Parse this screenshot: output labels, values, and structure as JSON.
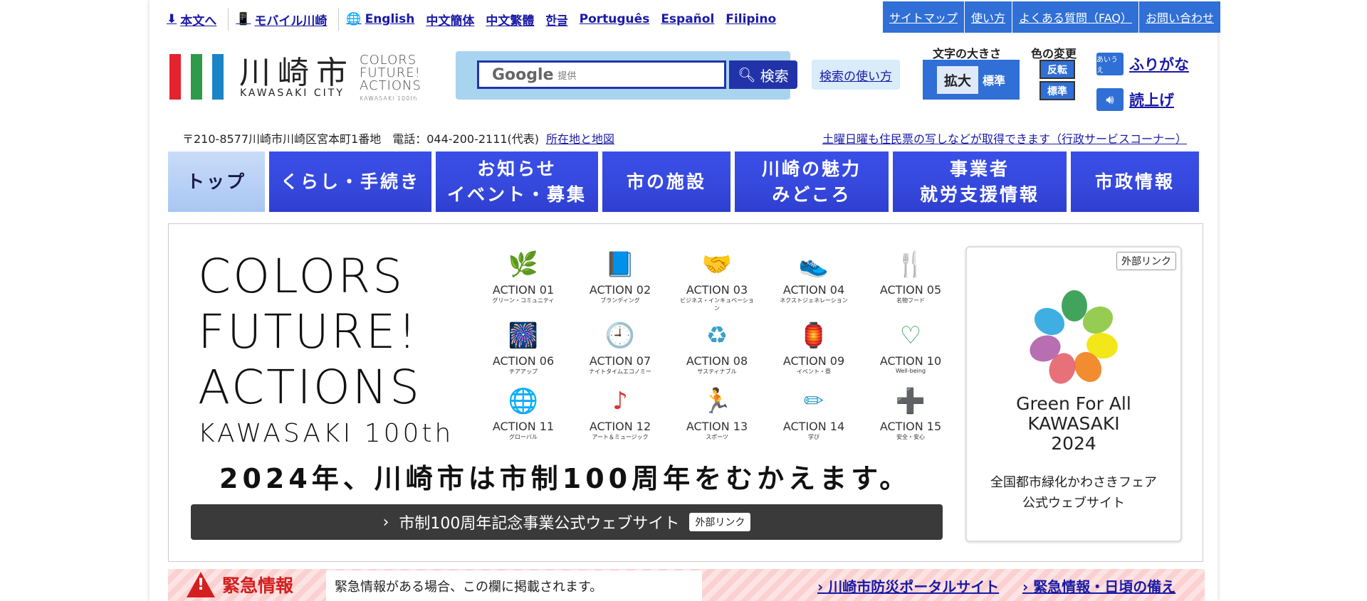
{
  "top_links": {
    "skip": "本文へ",
    "mobile": "モバイル川崎",
    "english": "English",
    "zh_cn": "中文簡体",
    "zh_tw": "中文繁體",
    "ko": "한글",
    "pt": "Português",
    "es": "Español",
    "fil": "Filipino"
  },
  "util_nav": {
    "sitemap": "サイトマップ",
    "howto": "使い方",
    "faq": "よくある質問（FAQ）",
    "contact": "お問い合わせ"
  },
  "logo": {
    "name": "川崎市",
    "sub": "KAWASAKI CITY",
    "cfa_lines": [
      "COLORS",
      "FUTURE!",
      "ACTIONS"
    ],
    "cfa_small": "KAWASAKI 100th"
  },
  "search": {
    "google": "Google",
    "provided": "提供",
    "button": "検索",
    "help": "検索の使い方"
  },
  "font_size": {
    "title": "文字の大きさ",
    "enlarge": "拡大",
    "standard": "標準"
  },
  "color_change": {
    "title": "色の変更",
    "invert": "反転",
    "standard": "標準"
  },
  "tools": {
    "furigana": "ふりがな",
    "furigana_icon": "あいうえ",
    "readaloud": "読上げ"
  },
  "address": {
    "text": "〒210-8577川崎市川崎区宮本町1番地　電話：044-200-2111(代表)",
    "map_link": "所在地と地図",
    "notice": "土曜日曜も住民票の写しなどが取得できます（行政サービスコーナー）"
  },
  "main_nav": [
    {
      "label": "トップ"
    },
    {
      "label": "くらし・手続き"
    },
    {
      "label": "お知らせ\nイベント・募集"
    },
    {
      "label": "市の施設"
    },
    {
      "label": "川崎の魅力\nみどころ"
    },
    {
      "label": "事業者\n就労支援情報"
    },
    {
      "label": "市政情報"
    }
  ],
  "banner": {
    "cfa_lines": [
      "COLORS",
      "FUTURE!",
      "ACTIONS"
    ],
    "cfa_kawasaki": "KAWASAKI 100th",
    "headline": "2024年、川崎市は市制100周年をむかえます。",
    "cta": "市制100周年記念事業公式ウェブサイト",
    "cta_badge": "外部リンク",
    "actions": [
      {
        "title": "ACTION 01",
        "sub": "グリーン・コミュニティ",
        "icon": "leaf-icon",
        "glyph": "🌿",
        "color": "#3aa55c"
      },
      {
        "title": "ACTION 02",
        "sub": "ブランディング",
        "icon": "book-icon",
        "glyph": "📘",
        "color": "#3aa0c8"
      },
      {
        "title": "ACTION 03",
        "sub": "ビジネス・インキュベーション",
        "icon": "handshake-icon",
        "glyph": "🤝",
        "color": "#d33"
      },
      {
        "title": "ACTION 04",
        "sub": "ネクストジェネレーション",
        "icon": "sneaker-icon",
        "glyph": "👟",
        "color": "#3aa55c"
      },
      {
        "title": "ACTION 05",
        "sub": "名物フード",
        "icon": "cutlery-icon",
        "glyph": "🍴",
        "color": "#3aa0c8"
      },
      {
        "title": "ACTION 06",
        "sub": "チアアップ",
        "icon": "fireworks-icon",
        "glyph": "🎆",
        "color": "#d33"
      },
      {
        "title": "ACTION 07",
        "sub": "ナイトタイムエコノミー",
        "icon": "clock-icon",
        "glyph": "🕘",
        "color": "#3aa55c"
      },
      {
        "title": "ACTION 08",
        "sub": "サスティナブル",
        "icon": "recycle-icon",
        "glyph": "♻",
        "color": "#3aa0c8"
      },
      {
        "title": "ACTION 09",
        "sub": "イベント・祭",
        "icon": "lantern-icon",
        "glyph": "🏮",
        "color": "#d33"
      },
      {
        "title": "ACTION 10",
        "sub": "Well-being",
        "icon": "heart-icon",
        "glyph": "♡",
        "color": "#3aa55c"
      },
      {
        "title": "ACTION 11",
        "sub": "グローバル",
        "icon": "globe-icon",
        "glyph": "🌐",
        "color": "#3aa0c8"
      },
      {
        "title": "ACTION 12",
        "sub": "アート＆ミュージック",
        "icon": "music-icon",
        "glyph": "♪",
        "color": "#d33"
      },
      {
        "title": "ACTION 13",
        "sub": "スポーツ",
        "icon": "runner-icon",
        "glyph": "🏃",
        "color": "#3aa55c"
      },
      {
        "title": "ACTION 14",
        "sub": "学び",
        "icon": "pencil-icon",
        "glyph": "✏",
        "color": "#3aa0c8"
      },
      {
        "title": "ACTION 15",
        "sub": "安全・安心",
        "icon": "firstaid-icon",
        "glyph": "➕",
        "color": "#d33"
      }
    ]
  },
  "gfa": {
    "badge": "外部リンク",
    "title_lines": [
      "Green For All",
      "KAWASAKI",
      "2024"
    ],
    "desc_lines": [
      "全国都市緑化かわさきフェア",
      "公式ウェブサイト"
    ]
  },
  "emergency": {
    "label": "緊急情報",
    "message": "緊急情報がある場合、この欄に掲載されます。",
    "link1": "川崎市防災ポータルサイト",
    "link2": "緊急情報・日頃の備え"
  },
  "colors": {
    "brand_blue": "#3648dc",
    "link": "#1a1aa6",
    "util_blue": "#2f6fd6",
    "emergency_red": "#d31f1f"
  }
}
